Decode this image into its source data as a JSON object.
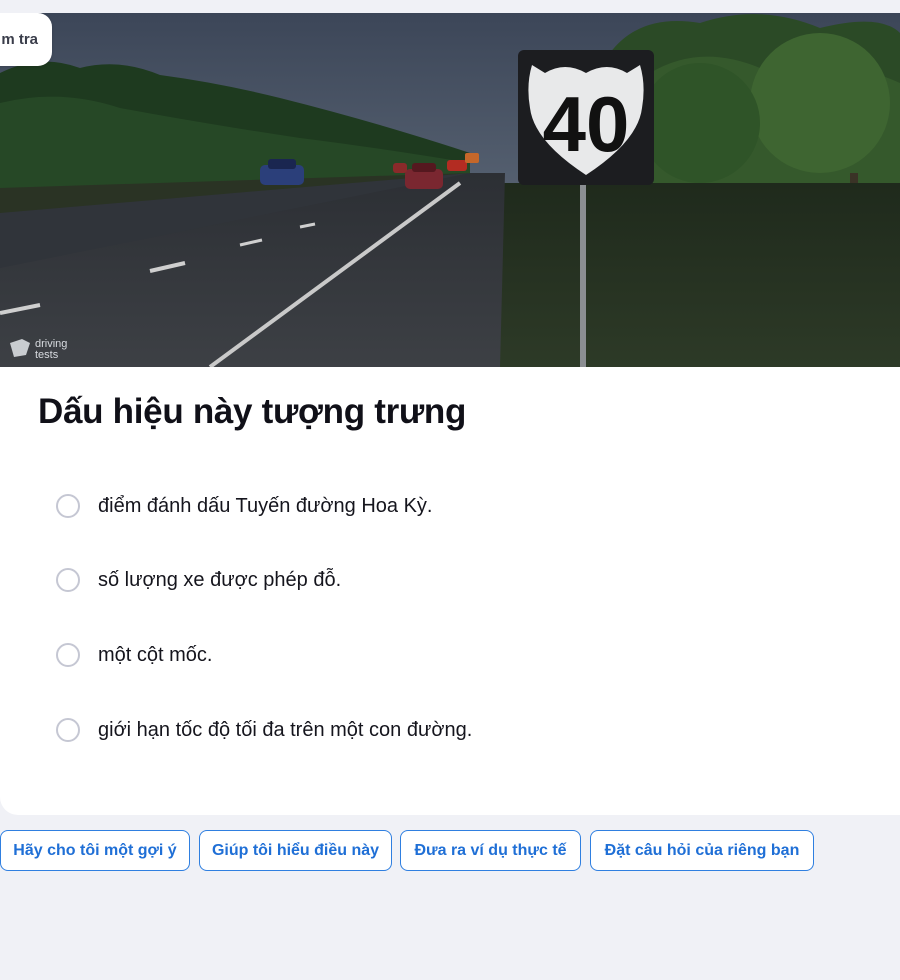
{
  "header": {
    "mode_label": "m tra"
  },
  "image": {
    "sign_number": "40",
    "watermark_line1": "driving",
    "watermark_line2": "tests"
  },
  "question": {
    "title": "Dấu hiệu này tượng trưng",
    "options": [
      {
        "label": "điểm đánh dấu Tuyến đường Hoa Kỳ.",
        "selected": false
      },
      {
        "label": "số lượng xe được phép đỗ.",
        "selected": false
      },
      {
        "label": "một cột mốc.",
        "selected": false
      },
      {
        "label": "giới hạn tốc độ tối đa trên một con đường.",
        "selected": false
      }
    ]
  },
  "actions": [
    {
      "label": "Hãy cho tôi một gợi ý"
    },
    {
      "label": "Giúp tôi hiểu điều này"
    },
    {
      "label": "Đưa ra ví dụ thực tế"
    },
    {
      "label": "Đặt câu hỏi của riêng bạn"
    }
  ],
  "colors": {
    "accent": "#2f7fe0",
    "background": "#f0f1f6",
    "card": "#ffffff"
  }
}
